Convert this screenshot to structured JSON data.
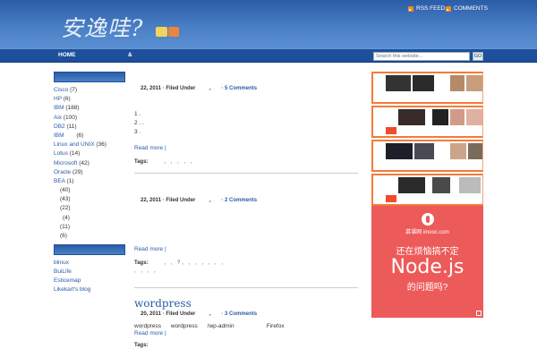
{
  "header": {
    "logo_text": "安逸哇?",
    "rss_feed": "RSS FEED",
    "comments": "COMMENTS"
  },
  "nav": {
    "home": "HOME",
    "amp": "&",
    "search_placeholder": "Search this website...",
    "go": "GO"
  },
  "sidebar": {
    "categories": [
      {
        "name": "Cisco",
        "count": "(7)"
      },
      {
        "name": "HP",
        "count": "(6)"
      },
      {
        "name": "IBM",
        "count": "(188)"
      },
      {
        "name": "Aix",
        "count": "(100)"
      },
      {
        "name": "DB2",
        "count": "(11)"
      },
      {
        "name": "IBM",
        "count": "(6)"
      },
      {
        "name": "Linux and UNIX",
        "count": "(36)"
      },
      {
        "name": "Lotus",
        "count": "(14)"
      },
      {
        "name": "Microsoft",
        "count": "(42)"
      },
      {
        "name": "Oracle",
        "count": "(29)"
      },
      {
        "name": "BEA",
        "count": "(1)"
      },
      {
        "name": "",
        "count": "(40)"
      },
      {
        "name": "",
        "count": "(43)"
      },
      {
        "name": "",
        "count": "(22)"
      },
      {
        "name": "",
        "count": "(4)"
      },
      {
        "name": "",
        "count": "(11)"
      },
      {
        "name": "",
        "count": "(6)"
      }
    ],
    "links": [
      "blinux",
      "BuiLife",
      "Esticemap",
      "Likekart's blog"
    ]
  },
  "posts": [
    {
      "title": "",
      "date": "22, 2011",
      "filed": "· Filed Under",
      "comments": "· 5 Comments",
      "lines": [
        "1    .",
        "2    .    .",
        "3    ."
      ],
      "read_more": "Read more |",
      "tags_label": "Tags:",
      "tags": ",    ,    ,    ,    ,"
    },
    {
      "title": "",
      "date": "22, 2011",
      "filed": "· Filed Under",
      "comments": "· 2 Comments",
      "lines": [],
      "read_more": "Read more |",
      "tags_label": "Tags:",
      "tags": ",    ,    ?,    ,    ,    ,    ,    ,    ,",
      "tags2": ",    ,    ,    ,"
    },
    {
      "title": "wordpress",
      "date": "20, 2011",
      "filed": "· Filed Under",
      "comments": "· 3 Comments",
      "lines": [
        "wordpress      wordpress      /wp-admin                    Firefox"
      ],
      "read_more": "Read more |",
      "tags_label": "Tags:",
      "tags": ""
    }
  ],
  "ads": {
    "mooc_brand": "慕课网 imooc.com",
    "mooc_line1": "还在烦恼搞不定",
    "mooc_line2": "Node.js",
    "mooc_line3": "的问题吗?"
  },
  "colors": {
    "header_blue": "#2a5ca8",
    "nav_blue": "#1d4f9b",
    "link_blue": "#2a5ca8",
    "ad_orange": "#f37b3a",
    "mooc_red": "#ed5a5a"
  }
}
